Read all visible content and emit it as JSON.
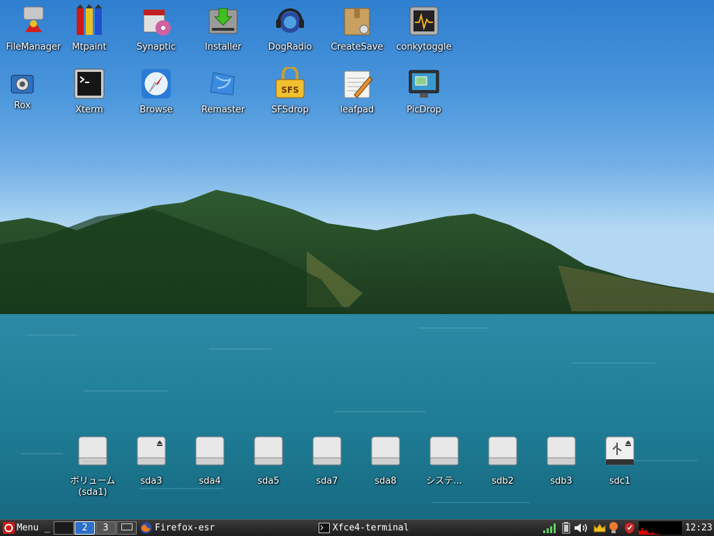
{
  "desktop_icons": [
    {
      "label": "FileManager",
      "icon": "file-manager-icon"
    },
    {
      "label": "Mtpaint",
      "icon": "mtpaint-icon"
    },
    {
      "label": "Synaptic",
      "icon": "synaptic-icon"
    },
    {
      "label": "Installer",
      "icon": "installer-icon"
    },
    {
      "label": "DogRadio",
      "icon": "dogradio-icon"
    },
    {
      "label": "CreateSave",
      "icon": "createsave-icon"
    },
    {
      "label": "conkytoggle",
      "icon": "conkytoggle-icon"
    },
    {
      "label": "Rox",
      "icon": "rox-icon"
    },
    {
      "label": "Xterm",
      "icon": "xterm-icon"
    },
    {
      "label": "Browse",
      "icon": "browse-icon"
    },
    {
      "label": "Remaster",
      "icon": "remaster-icon"
    },
    {
      "label": "SFSdrop",
      "icon": "sfsdrop-icon"
    },
    {
      "label": "leafpad",
      "icon": "leafpad-icon"
    },
    {
      "label": "PicDrop",
      "icon": "picdrop-icon"
    }
  ],
  "sfs_badge": "SFS",
  "drives": [
    {
      "label": "ボリューム (sda1)",
      "icon": "drive-icon"
    },
    {
      "label": "sda3",
      "icon": "drive-mounted-icon"
    },
    {
      "label": "sda4",
      "icon": "drive-icon"
    },
    {
      "label": "sda5",
      "icon": "drive-icon"
    },
    {
      "label": "sda7",
      "icon": "drive-icon"
    },
    {
      "label": "sda8",
      "icon": "drive-icon"
    },
    {
      "label": "システ...",
      "icon": "drive-icon"
    },
    {
      "label": "sdb2",
      "icon": "drive-icon"
    },
    {
      "label": "sdb3",
      "icon": "drive-icon"
    },
    {
      "label": "sdc1",
      "icon": "usb-drive-icon"
    }
  ],
  "taskbar": {
    "menu_label": "Menu",
    "separator": "_",
    "pager": [
      "",
      "2",
      "3",
      ""
    ],
    "tasks": [
      {
        "label": "Firefox-esr",
        "icon": "firefox-icon"
      },
      {
        "label": "Xfce4-terminal",
        "icon": "terminal-icon"
      }
    ],
    "tray_icons": [
      "signal-icon",
      "battery-icon",
      "volume-icon",
      "crown-icon",
      "lightbulb-icon",
      "shield-icon",
      "cpu-graph-icon"
    ],
    "clock": "12:23"
  },
  "colors": {
    "taskbar_bg": "#2b2b2b",
    "pager_active": "#2a6fc9",
    "cpu_graph": "#e00000"
  }
}
